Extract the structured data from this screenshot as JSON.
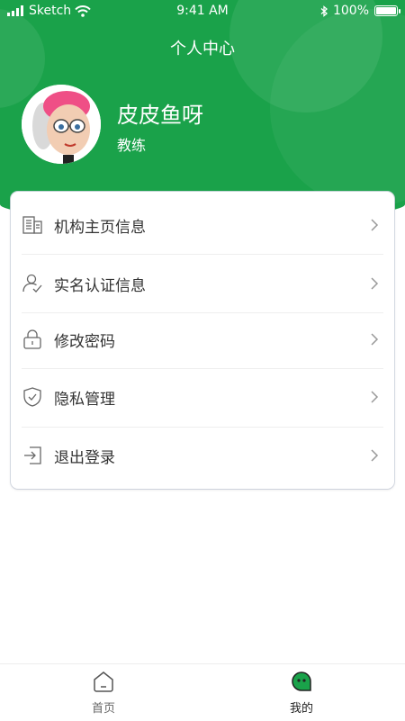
{
  "status_bar": {
    "carrier": "Sketch",
    "time": "9:41 AM",
    "battery": "100%",
    "battery_level": 1.0
  },
  "header": {
    "title": "个人中心",
    "username": "皮皮鱼呀",
    "role": "教练"
  },
  "menu": [
    {
      "label": "机构主页信息",
      "icon": "building-icon"
    },
    {
      "label": "实名认证信息",
      "icon": "user-verify-icon"
    },
    {
      "label": "修改密码",
      "icon": "lock-icon"
    },
    {
      "label": "隐私管理",
      "icon": "shield-check-icon"
    },
    {
      "label": "退出登录",
      "icon": "logout-icon"
    }
  ],
  "tabs": [
    {
      "label": "首页",
      "icon": "home-icon",
      "active": false
    },
    {
      "label": "我的",
      "icon": "profile-face-icon",
      "active": true
    }
  ],
  "colors": {
    "primary": "#1aa24a",
    "text": "#333333",
    "muted": "#666666"
  }
}
